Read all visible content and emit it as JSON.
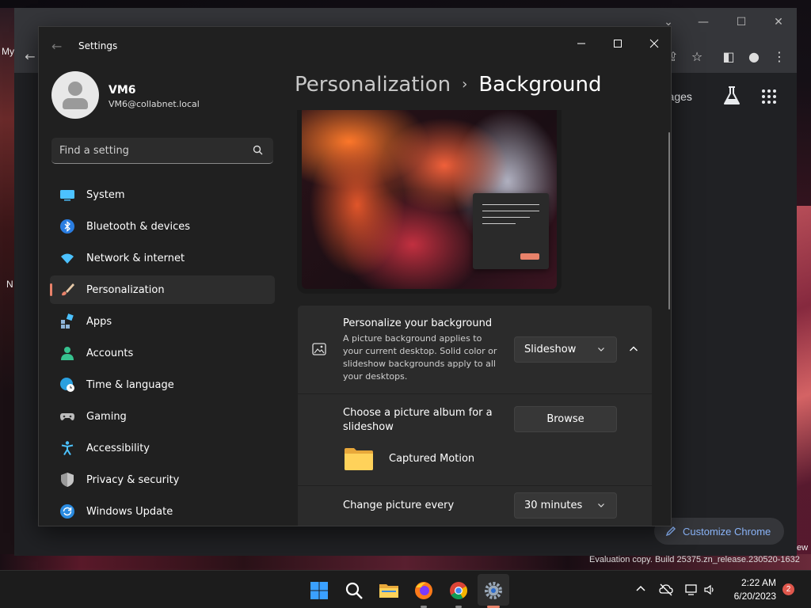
{
  "desktop": {
    "left_text_top": "My",
    "left_text_bottom": "N",
    "right_text": "ew"
  },
  "chrome": {
    "images_link": "Images",
    "customize_label": "Customize Chrome"
  },
  "watermark": "Evaluation copy. Build 25375.zn_release.230520-1632",
  "settings": {
    "title": "Settings",
    "user": {
      "name": "VM6",
      "email": "VM6@collabnet.local"
    },
    "search": {
      "placeholder": "Find a setting"
    },
    "nav": [
      {
        "label": "System",
        "icon": "monitor-icon"
      },
      {
        "label": "Bluetooth & devices",
        "icon": "bluetooth-icon"
      },
      {
        "label": "Network & internet",
        "icon": "wifi-icon"
      },
      {
        "label": "Personalization",
        "icon": "brush-icon",
        "active": true
      },
      {
        "label": "Apps",
        "icon": "apps-icon"
      },
      {
        "label": "Accounts",
        "icon": "person-icon"
      },
      {
        "label": "Time & language",
        "icon": "globe-clock-icon"
      },
      {
        "label": "Gaming",
        "icon": "gamepad-icon"
      },
      {
        "label": "Accessibility",
        "icon": "accessibility-icon"
      },
      {
        "label": "Privacy & security",
        "icon": "shield-icon"
      },
      {
        "label": "Windows Update",
        "icon": "update-icon"
      }
    ],
    "breadcrumb": {
      "parent": "Personalization",
      "separator": "›",
      "current": "Background"
    },
    "personalize": {
      "title": "Personalize your background",
      "description": "A picture background applies to your current desktop. Solid color or slideshow backgrounds apply to all your desktops.",
      "value": "Slideshow"
    },
    "album": {
      "label": "Choose a picture album for a slideshow",
      "button": "Browse",
      "folder_name": "Captured Motion"
    },
    "interval": {
      "label": "Change picture every",
      "value": "30 minutes"
    }
  },
  "taskbar": {
    "time": "2:22 AM",
    "date": "6/20/2023",
    "notification_count": "2"
  },
  "colors": {
    "accent": "#e8826a",
    "settings_bg": "#202020",
    "card_bg": "#2b2b2b",
    "chrome_link": "#8ab4f8"
  }
}
